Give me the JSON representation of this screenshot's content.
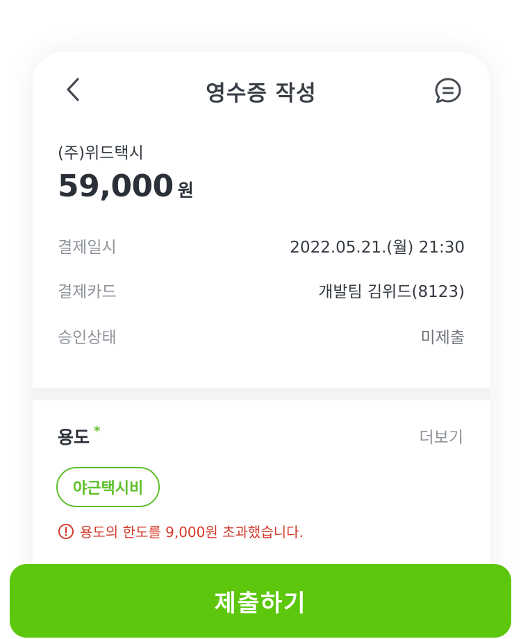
{
  "header": {
    "title": "영수증 작성",
    "back_icon": "chevron-left-icon",
    "chat_icon": "chat-bubble-icon"
  },
  "receipt": {
    "merchant": "(주)위드택시",
    "amount": "59,000",
    "currency_unit": "원",
    "rows": [
      {
        "label": "결제일시",
        "value": "2022.05.21.(월) 21:30"
      },
      {
        "label": "결제카드",
        "value": "개발팀 김위드(8123)"
      },
      {
        "label": "승인상태",
        "value": "미제출"
      }
    ]
  },
  "purpose": {
    "title": "용도",
    "required_mark": "*",
    "more_label": "더보기",
    "selected_chip": "야근택시비",
    "warning_text": "용도의 한도를 9,000원 초과했습니다."
  },
  "footer": {
    "submit_label": "제출하기"
  },
  "colors": {
    "accent": "#5cc70d",
    "warning": "#d33a2c"
  }
}
